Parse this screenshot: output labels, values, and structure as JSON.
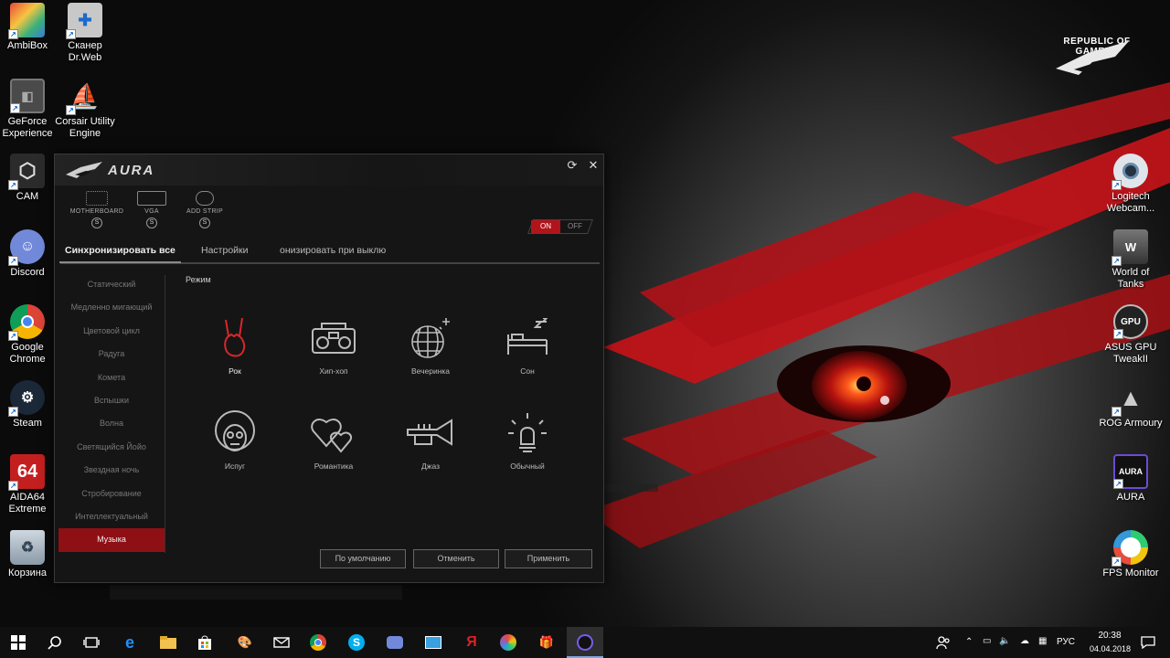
{
  "desktop": {
    "left_icons": [
      {
        "label": "AmbiBox",
        "color": "#d94f3a"
      },
      {
        "label": "Сканер Dr.Web",
        "color": "#bbbbbb"
      },
      {
        "label": "GeForce Experience",
        "color": "#555555"
      },
      {
        "label": "Corsair Utility Engine",
        "color": "#222222"
      },
      {
        "label": "CAM",
        "color": "#3a3a3a"
      },
      {
        "label": "Discord",
        "color": "#6d7fd0"
      },
      {
        "label": "Google Chrome",
        "color": "#e8e8e8"
      },
      {
        "label": "Steam",
        "color": "#1b2838"
      },
      {
        "label": "AIDA64 Extreme",
        "color": "#c41f1f"
      },
      {
        "label": "Корзина",
        "color": "#9ab"
      }
    ],
    "right_icons": [
      {
        "label": "Logitech Webcam...",
        "color": "#cfd6dc"
      },
      {
        "label": "World of Tanks",
        "color": "#4a4a4a"
      },
      {
        "label": "ASUS GPU TweakII",
        "color": "#2a2a2a"
      },
      {
        "label": "ROG Armoury",
        "color": "#1a1a1a"
      },
      {
        "label": "AURA",
        "color": "#111111"
      },
      {
        "label": "FPS Monitor",
        "color": "#222222"
      }
    ],
    "aida_badge": "64",
    "brand_line1": "REPUBLIC OF",
    "brand_line2": "GAMERS"
  },
  "aura": {
    "title": "AURA",
    "devices": [
      {
        "label": "MOTHERBOARD"
      },
      {
        "label": "VGA"
      },
      {
        "label": "ADD STRIP"
      }
    ],
    "toggle": {
      "on": "ON",
      "off": "OFF"
    },
    "tabs": [
      {
        "label": "Синхронизировать все"
      },
      {
        "label": "Настройки"
      },
      {
        "label": "онизировать при выклю"
      }
    ],
    "effects": [
      "Статический",
      "Медленно мигающий",
      "Цветовой цикл",
      "Радуга",
      "Комета",
      "Вспышки",
      "Волна",
      "Светящийся Йойо",
      "Звездная ночь",
      "Стробирование",
      "Интеллектуальный",
      "Музыка"
    ],
    "active_effect_index": 11,
    "mode_label": "Режим",
    "modes": [
      {
        "label": "Рок",
        "icon": "rock-hand-icon"
      },
      {
        "label": "Хип-хоп",
        "icon": "boombox-icon"
      },
      {
        "label": "Вечеринка",
        "icon": "disco-ball-icon"
      },
      {
        "label": "Сон",
        "icon": "bed-icon"
      },
      {
        "label": "Испуг",
        "icon": "afro-face-icon"
      },
      {
        "label": "Романтика",
        "icon": "hearts-icon"
      },
      {
        "label": "Джаз",
        "icon": "trumpet-icon"
      },
      {
        "label": "Обычный",
        "icon": "lamp-icon"
      }
    ],
    "selected_mode": "Рок",
    "buttons": {
      "default": "По умолчанию",
      "cancel": "Отменить",
      "apply": "Применить"
    },
    "accent": "#b1141a"
  },
  "taskbar": {
    "language": "РУС",
    "time": "20:38",
    "date": "04.04.2018"
  }
}
